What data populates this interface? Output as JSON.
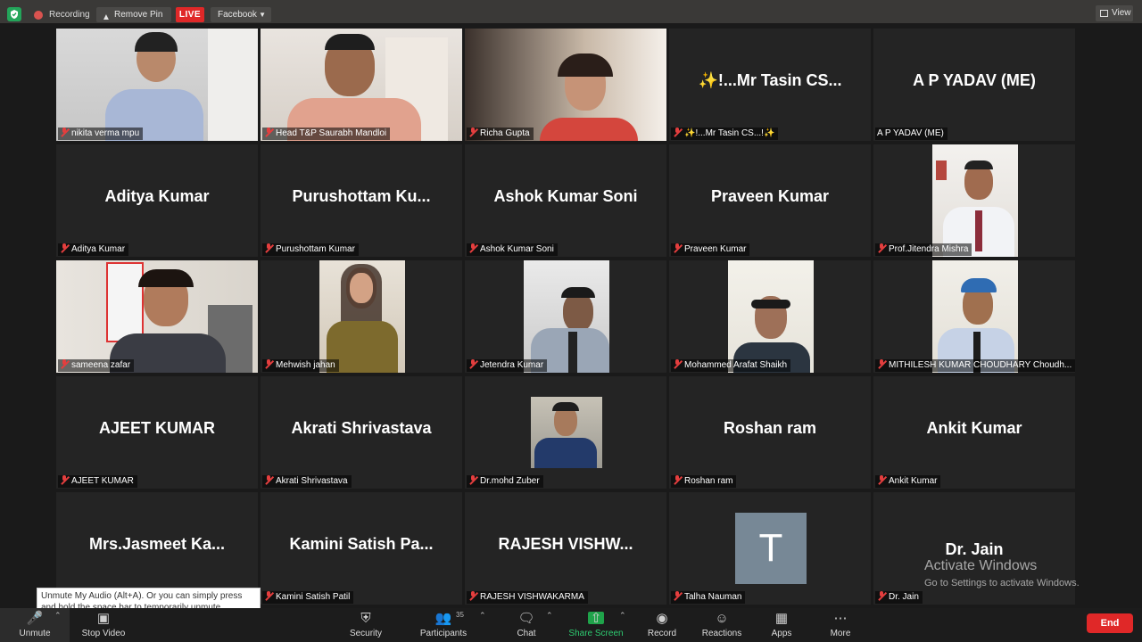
{
  "topbar": {
    "recording": "Recording",
    "remove_pin": "Remove Pin",
    "live": "LIVE",
    "platform": "Facebook",
    "view": "View"
  },
  "tiles": [
    {
      "label": "nikita verma mpu",
      "name": ""
    },
    {
      "label": "Head T&P Saurabh Mandloi",
      "name": ""
    },
    {
      "label": "Richa Gupta",
      "name": ""
    },
    {
      "label": "✨!...Mr Tasin CS...!✨",
      "name": "✨!...Mr Tasin CS..."
    },
    {
      "label": "A P YADAV (ME)",
      "name": "A P YADAV (ME)"
    },
    {
      "label": "Aditya Kumar",
      "name": "Aditya Kumar"
    },
    {
      "label": "Purushottam Kumar",
      "name": "Purushottam  Ku..."
    },
    {
      "label": "Ashok Kumar Soni",
      "name": "Ashok Kumar Soni"
    },
    {
      "label": "Praveen Kumar",
      "name": "Praveen Kumar"
    },
    {
      "label": "Prof.Jitendra Mishra",
      "name": ""
    },
    {
      "label": "sameena zafar",
      "name": ""
    },
    {
      "label": "Mehwish jahan",
      "name": ""
    },
    {
      "label": "Jetendra Kumar",
      "name": ""
    },
    {
      "label": "Mohammed Arafat Shaikh",
      "name": ""
    },
    {
      "label": "MITHILESH KUMAR CHOUDHARY Choudh...",
      "name": ""
    },
    {
      "label": "AJEET KUMAR",
      "name": "AJEET KUMAR"
    },
    {
      "label": "Akrati Shrivastava",
      "name": "Akrati Shrivastava"
    },
    {
      "label": "Dr.mohd Zuber",
      "name": ""
    },
    {
      "label": "Roshan ram",
      "name": "Roshan ram"
    },
    {
      "label": "Ankit Kumar",
      "name": "Ankit Kumar"
    },
    {
      "label": "",
      "name": "Mrs.Jasmeet  Ka..."
    },
    {
      "label": "Kamini Satish Patil",
      "name": "Kamini Satish Pa..."
    },
    {
      "label": "RAJESH VISHWAKARMA",
      "name": "RAJESH  VISHW..."
    },
    {
      "label": "Talha Nauman",
      "name": "",
      "avatar": "T"
    },
    {
      "label": "Dr. Jain",
      "name": "Dr. Jain"
    }
  ],
  "tooltip": "Unmute My Audio (Alt+A). Or you can simply press and hold the space bar to temporarily unmute.",
  "watermark": {
    "line1": "Activate Windows",
    "line2": "Go to Settings to activate Windows."
  },
  "toolbar": {
    "unmute": "Unmute",
    "stop_video": "Stop Video",
    "security": "Security",
    "participants": "Participants",
    "participants_count": "35",
    "chat": "Chat",
    "share_screen": "Share Screen",
    "record": "Record",
    "reactions": "Reactions",
    "apps": "Apps",
    "more": "More",
    "end": "End"
  },
  "colors": {
    "live": "#e02828",
    "share": "#2ecc71",
    "end": "#e02828",
    "avatar": "#778896"
  }
}
